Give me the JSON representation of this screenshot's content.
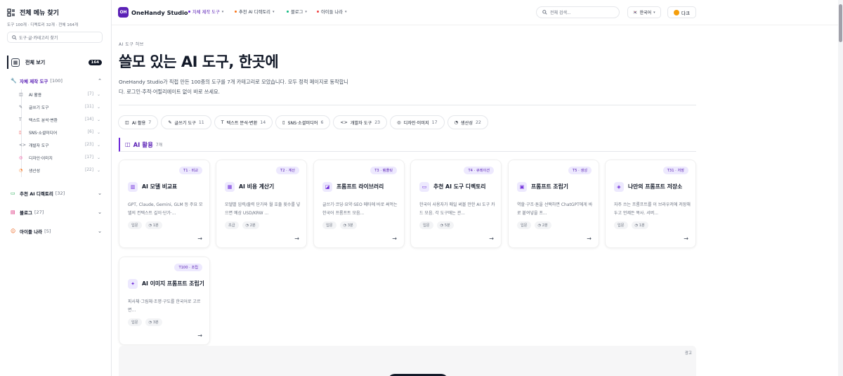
{
  "sidebar": {
    "title": "전체 메뉴 찾기",
    "stats": "도구 100개 · 디렉토리 32개 · 전체 164개",
    "search_placeholder": "도구·글·카테고리 찾기",
    "all": {
      "label": "전체 보기",
      "count": "164"
    },
    "categories": [
      {
        "icon": "wrench-icon",
        "label": "자체 제작 도구",
        "count": "[100]",
        "color": "#5b21b6"
      },
      {
        "icon": "folder-icon",
        "label": "추천 AI 디렉토리",
        "count": "[32]",
        "color": "#111827"
      },
      {
        "icon": "book-icon",
        "label": "블로그",
        "count": "[27]",
        "color": "#111827"
      },
      {
        "icon": "smile-icon",
        "label": "아이들 나라",
        "count": "[5]",
        "color": "#111827"
      }
    ],
    "subs": [
      {
        "icon": "robot-icon",
        "label": "AI 활용",
        "count": "[7]"
      },
      {
        "icon": "pen-icon",
        "label": "글쓰기 도구",
        "count": "[11]"
      },
      {
        "icon": "text-icon",
        "label": "텍스트 분석·변환",
        "count": "[14]"
      },
      {
        "icon": "phone-icon",
        "label": "SNS·소셜미디어",
        "count": "[6]"
      },
      {
        "icon": "code-icon",
        "label": "개발자 도구",
        "count": "[23]"
      },
      {
        "icon": "palette-icon",
        "label": "디자인·이미지",
        "count": "[17]"
      },
      {
        "icon": "clock-icon",
        "label": "생산성",
        "count": "[22]"
      }
    ]
  },
  "topbar": {
    "logo_mark": "OH",
    "brand": "OneHandy Studio",
    "nav": [
      {
        "label": "자체 제작 도구",
        "color": "#6d28d9"
      },
      {
        "label": "추천 AI 디렉토리",
        "color": "#f97316"
      },
      {
        "label": "블로그",
        "color": "#10b981"
      },
      {
        "label": "아이들 나라",
        "color": "#ef4444"
      }
    ],
    "search_placeholder": "전체 검색...",
    "lang": "한국어",
    "dark": "다크"
  },
  "hero": {
    "eyebrow": "AI 도구 허브",
    "title": "쓸모 있는 AI 도구, 한곳에",
    "desc": "OneHandy Studio가 직접 만든 100종의 도구를 7개 카테고리로 모았습니다. 모두 정적 페이지로 동작합니다. 로그인·추적·어필리에이트 없이 바로 쓰세요."
  },
  "chips": [
    {
      "icon": "robot-icon",
      "label": "AI 활용",
      "count": "7"
    },
    {
      "icon": "pen-icon",
      "label": "글쓰기 도구",
      "count": "11"
    },
    {
      "icon": "text-icon",
      "label": "텍스트 분석·변환",
      "count": "14"
    },
    {
      "icon": "phone-icon",
      "label": "SNS·소셜미디어",
      "count": "6"
    },
    {
      "icon": "code-icon",
      "label": "개발자 도구",
      "count": "23"
    },
    {
      "icon": "palette-icon",
      "label": "디자인·이미지",
      "count": "17"
    },
    {
      "icon": "clock-icon",
      "label": "생산성",
      "count": "22"
    }
  ],
  "section": {
    "title": "AI 활용",
    "count": "7개"
  },
  "cards": [
    {
      "tag": "T1 · 비교",
      "icon": "chart-icon",
      "title": "AI 모델 비교표",
      "desc": "GPT, Claude, Gemini, GLM 등 주요 모델의 컨텍스트 길이·단가·...",
      "level": "입문",
      "time": "1분"
    },
    {
      "tag": "T2 · 계산",
      "icon": "calculator-icon",
      "title": "AI 비용 계산기",
      "desc": "모델별 입력/출력 단가와 월 호출 횟수를 넣으면 예상 USD/KRW ...",
      "level": "초급",
      "time": "2분"
    },
    {
      "tag": "T3 · 템플릿",
      "icon": "library-icon",
      "title": "프롬프트 라이브러리",
      "desc": "글쓰기·코딩·요약·SEO 메타에 바로 써먹는 한국어 프롬프트 모음...",
      "level": "입문",
      "time": "3분"
    },
    {
      "tag": "T4 · 큐레이션",
      "icon": "folder-icon",
      "title": "추천 AI 도구 디렉토리",
      "desc": "한국어 사용자가 매일 써볼 만한 AI 도구 카드 모음. 각 도구에는 관...",
      "level": "입문",
      "time": "5분"
    },
    {
      "tag": "T5 · 생성",
      "icon": "blocks-icon",
      "title": "프롬프트 조립기",
      "desc": "역할·구조·톤을 선택하면 ChatGPT에게 바로 붙여넣을 프...",
      "level": "입문",
      "time": "2분"
    },
    {
      "tag": "T31 · 저장",
      "icon": "save-icon",
      "title": "나만의 프롬프트 저장소",
      "desc": "자주 쓰는 프롬프트를 이 브라우저에 저장해두고 언제든 복사. 서버...",
      "level": "입문",
      "time": "1분"
    },
    {
      "tag": "T100 · 조립",
      "icon": "magic-icon",
      "title": "AI 이미지 프롬프트 조립기",
      "desc": "피사체·그림체·조명·구도를 한국어로 고르면...",
      "level": "입문",
      "time": "3분"
    }
  ],
  "ad": {
    "label": "광고"
  }
}
